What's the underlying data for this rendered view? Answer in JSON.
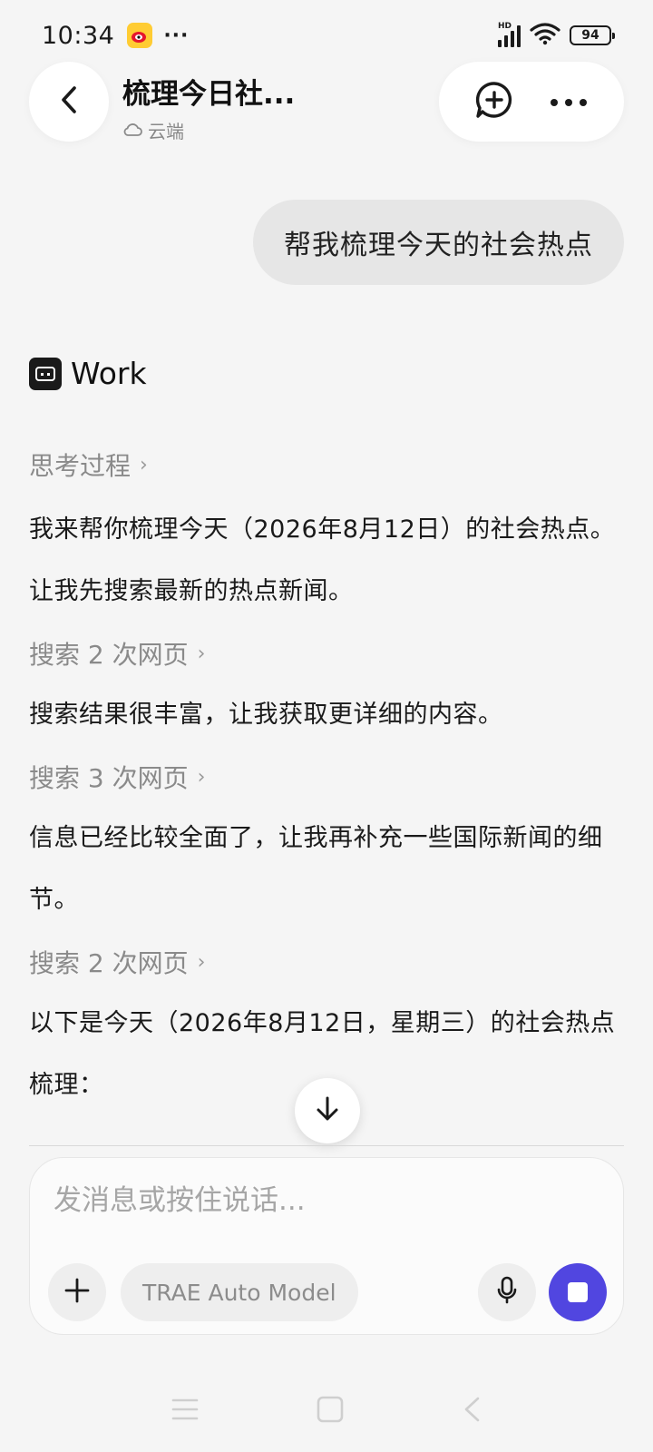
{
  "status_bar": {
    "time": "10:34",
    "hd_label": "HD",
    "battery_level": "94",
    "notification_icons": [
      "weibo-icon",
      "more-dots-icon"
    ]
  },
  "header": {
    "title": "梳理今日社...",
    "subtitle": "云端",
    "subtitle_icon": "cloud-icon"
  },
  "conversation": {
    "user_message": "帮我梳理今天的社会热点",
    "agent_name": "Work",
    "thinking_label": "思考过程",
    "blocks": [
      {
        "type": "text",
        "text": "我来帮你梳理今天（2026年8月12日）的社会热点。让我先搜索最新的热点新闻。"
      },
      {
        "type": "search",
        "label": "搜索 2 次网页"
      },
      {
        "type": "text",
        "text": "搜索结果很丰富，让我获取更详细的内容。"
      },
      {
        "type": "search",
        "label": "搜索 3 次网页"
      },
      {
        "type": "text",
        "text": "信息已经比较全面了，让我再补充一些国际新闻的细节。"
      },
      {
        "type": "search",
        "label": "搜索 2 次网页"
      },
      {
        "type": "text",
        "text": "以下是今天（2026年8月12日，星期三）的社会热点梳理："
      }
    ]
  },
  "composer": {
    "placeholder": "发消息或按住说话...",
    "model_label": "TRAE Auto Model"
  },
  "colors": {
    "accent": "#5146e0",
    "background": "#f5f5f5",
    "user_bubble": "#e6e6e6"
  }
}
